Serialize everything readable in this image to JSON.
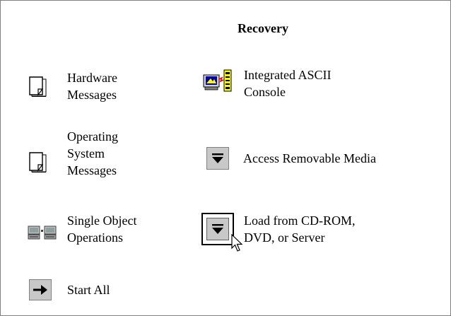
{
  "panel": {
    "title": "Recovery"
  },
  "items": [
    {
      "key": "hardware_messages",
      "lines": [
        "Hardware",
        "Messages"
      ],
      "icon": "document-icon"
    },
    {
      "key": "integrated_ascii_console",
      "lines": [
        "Integrated ASCII",
        "Console"
      ],
      "icon": "computer-console-icon"
    },
    {
      "key": "operating_system_messages",
      "lines": [
        "Operating",
        "System",
        "Messages"
      ],
      "icon": "document-icon"
    },
    {
      "key": "access_removable_media",
      "lines": [
        "Access Removable Media"
      ],
      "icon": "down-arrow-button-icon"
    },
    {
      "key": "single_object_operations",
      "lines": [
        "Single Object",
        "Operations"
      ],
      "icon": "server-pair-icon"
    },
    {
      "key": "load_from_cd_rom",
      "lines": [
        "Load from CD-ROM,",
        "DVD, or Server"
      ],
      "icon": "down-arrow-button-icon"
    },
    {
      "key": "start_all",
      "lines": [
        "Start All"
      ],
      "icon": "right-arrow-button-icon"
    }
  ],
  "colors": {
    "button_face": "#c8c8c8",
    "border": "#808080",
    "console_yellow": "#ffff00",
    "console_blue": "#0000aa",
    "console_red": "#ff0000"
  }
}
